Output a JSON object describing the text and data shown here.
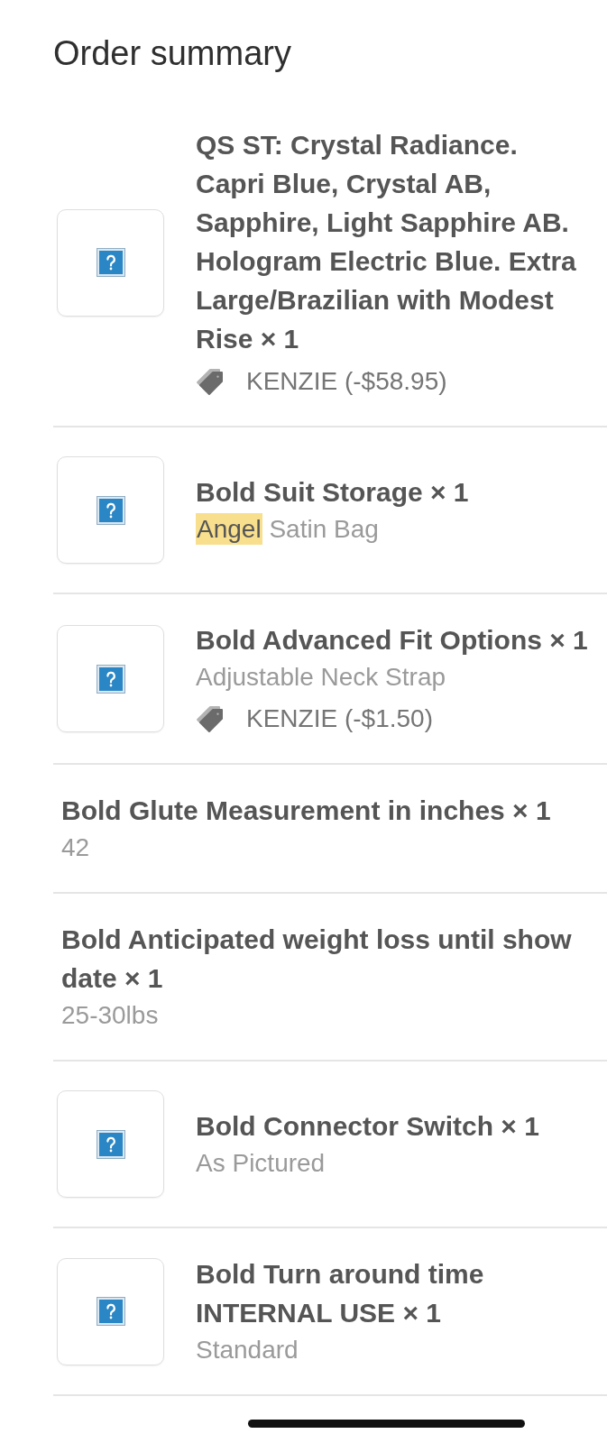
{
  "title": "Order summary",
  "items": [
    {
      "kind": "product",
      "name": "QS ST: Crystal Radiance. Capri Blue, Crystal AB, Sapphire, Light Sapphire AB. Hologram Electric Blue. Extra Large/Brazilian with Modest Rise × 1",
      "discount": "KENZIE (-$58.95)"
    },
    {
      "kind": "product",
      "name": "Bold Suit Storage × 1",
      "options": [
        {
          "text": "Angel",
          "highlighted": true
        },
        {
          "text": "Satin Bag",
          "highlighted": false
        }
      ]
    },
    {
      "kind": "product",
      "name": "Bold Advanced Fit Options × 1",
      "options": [
        {
          "text": "Adjustable Neck Strap",
          "highlighted": false
        }
      ],
      "discount": "KENZIE (-$1.50)"
    },
    {
      "kind": "property",
      "name": "Bold Glute Measurement in inches × 1",
      "options": [
        {
          "text": "42",
          "highlighted": false
        }
      ]
    },
    {
      "kind": "property",
      "name": "Bold Anticipated weight loss until show date × 1",
      "options": [
        {
          "text": "25-30lbs",
          "highlighted": false
        }
      ]
    },
    {
      "kind": "product",
      "name": "Bold Connector Switch × 1",
      "options": [
        {
          "text": "As Pictured",
          "highlighted": false
        }
      ]
    },
    {
      "kind": "product",
      "name": "Bold Turn around time INTERNAL USE × 1",
      "options": [
        {
          "text": "Standard",
          "highlighted": false
        }
      ]
    }
  ]
}
